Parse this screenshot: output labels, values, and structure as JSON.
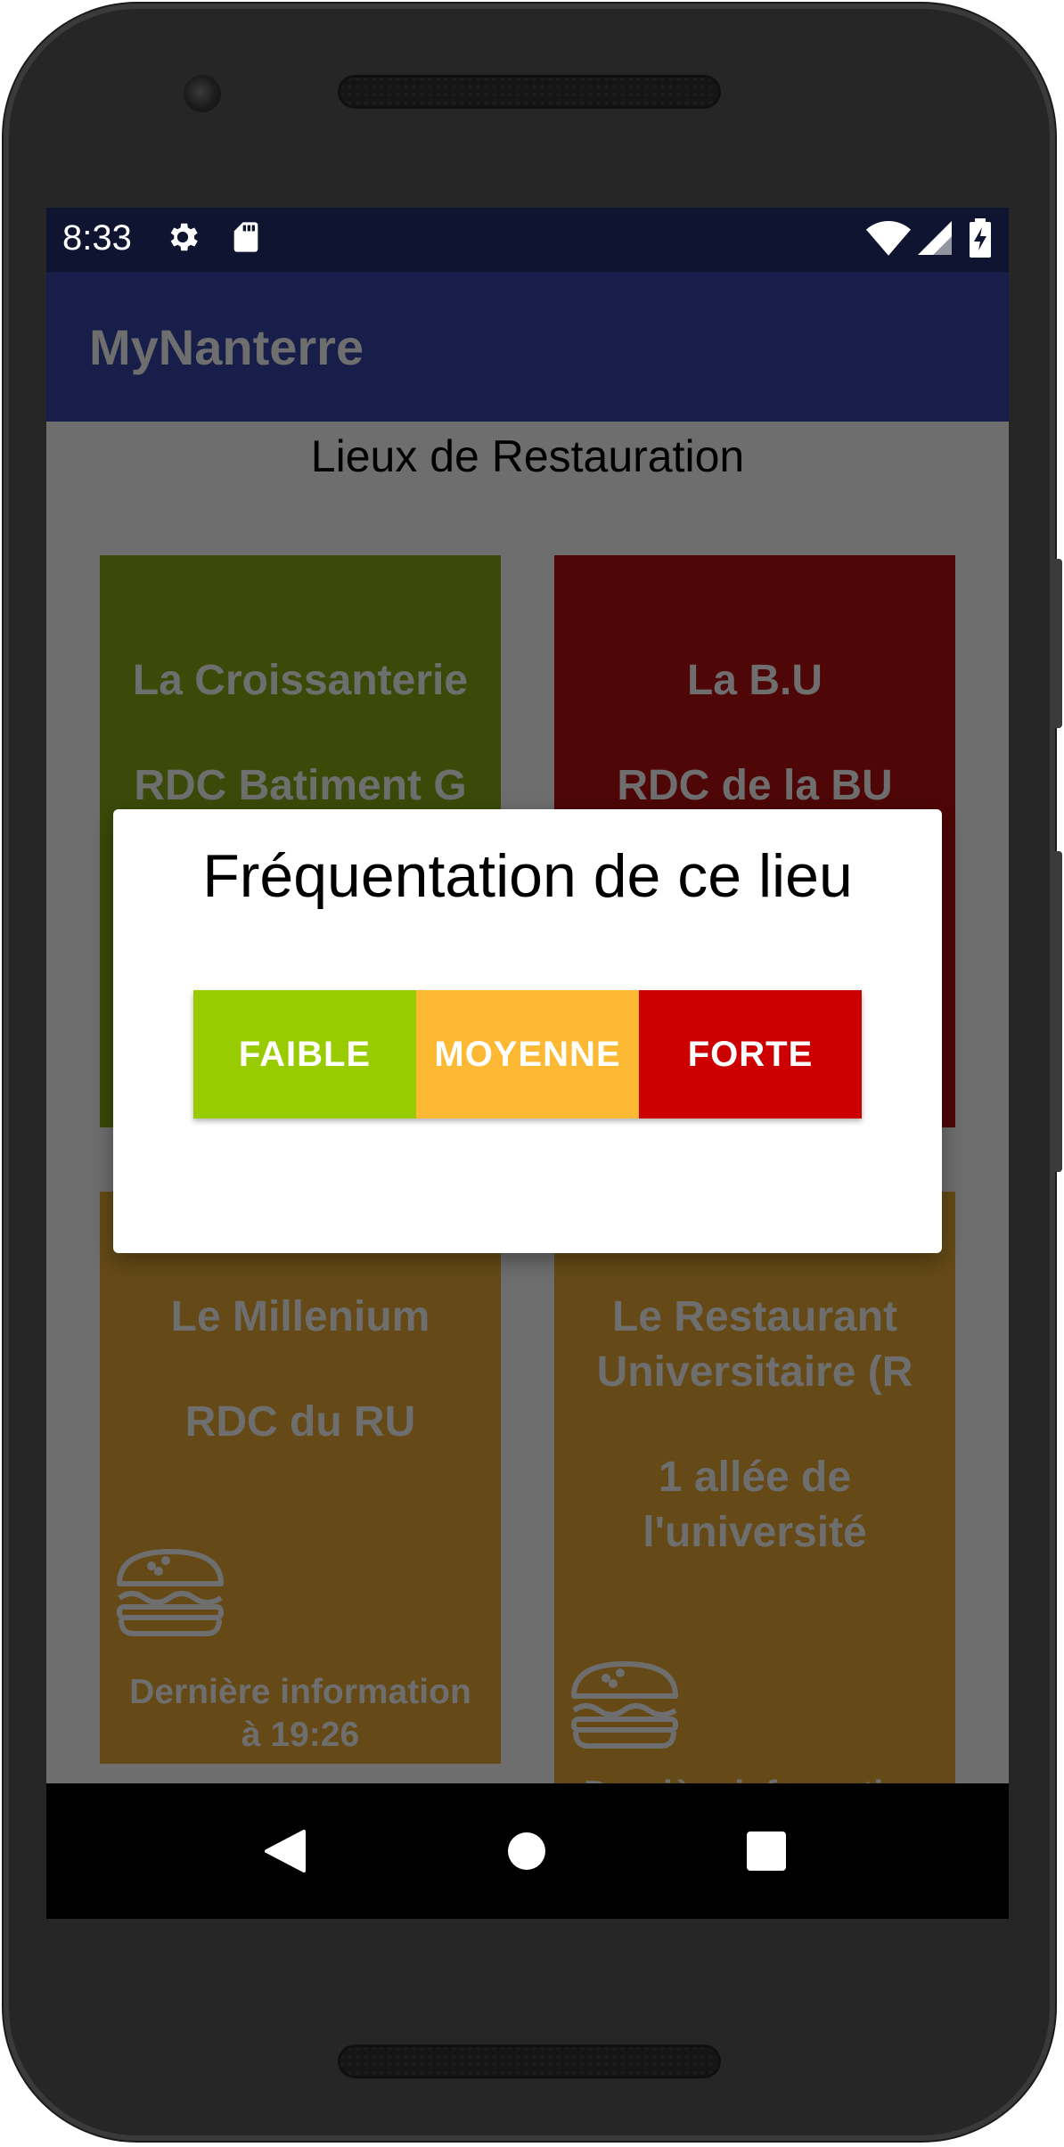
{
  "status_bar": {
    "time": "8:33",
    "icons": [
      "gear-icon",
      "sd-card-icon",
      "wifi-icon",
      "signal-icon",
      "battery-charging-icon"
    ]
  },
  "app_bar": {
    "title": "MyNanterre"
  },
  "page": {
    "title": "Lieux de Restauration"
  },
  "colors": {
    "status_bar": "#0f1530",
    "app_bar": "#181e4a",
    "scrim_background": "#6e6e6e",
    "card_croissanterie": "#3b4a09",
    "card_bu": "#4e0606",
    "card_millenium": "#654a17",
    "card_ru": "#654a17",
    "level_faible": "#99cc00",
    "level_moyenne": "#fdb933",
    "level_forte": "#cc0000"
  },
  "cards": [
    {
      "name": "La Croissanterie",
      "address": "RDC  Batiment G"
    },
    {
      "name": "La B.U",
      "address": "RDC de la BU"
    },
    {
      "name": "Le Millenium",
      "address": "RDC du RU",
      "info": "Dernière information\nà 19:26",
      "icon": "burger-icon"
    },
    {
      "name": "Le Restaurant\nUniversitaire (R",
      "address": "1 allée de\nl'université",
      "info": "Dernière information",
      "icon": "burger-icon"
    }
  ],
  "dialog": {
    "title": "Fréquentation de ce lieu",
    "buttons": {
      "faible": "FAIBLE",
      "moyenne": "MOYENNE",
      "forte": "FORTE"
    }
  },
  "nav_bar": {
    "icons": [
      "back-icon",
      "home-icon",
      "recents-icon"
    ]
  }
}
